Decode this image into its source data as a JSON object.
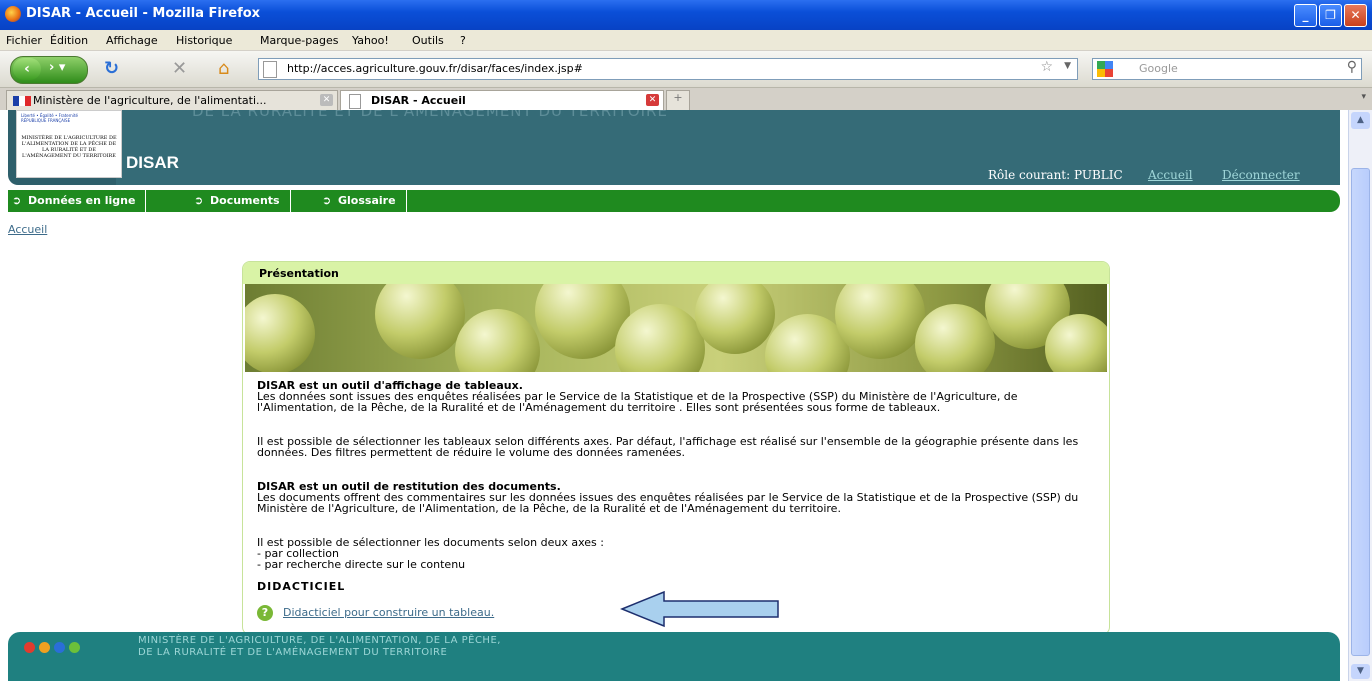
{
  "window": {
    "title": "DISAR - Accueil - Mozilla Firefox"
  },
  "menu": [
    "Fichier",
    "Édition",
    "Affichage",
    "Historique",
    "Marque-pages",
    "Yahoo!",
    "Outils",
    "?"
  ],
  "navbar": {
    "url": "http://acces.agriculture.gouv.fr/disar/faces/index.jsp#",
    "search_placeholder": "Google"
  },
  "tabs": [
    {
      "label": "Ministère de l'agriculture, de l'alimentati..."
    },
    {
      "label": "DISAR - Accueil"
    }
  ],
  "header": {
    "tagline": "DE LA RURALITÉ ET DE L'AMÉNAGEMENT DU TERRITOIRE",
    "logo_motto": "Liberté • Égalité • Fraternité",
    "logo_republic": "RÉPUBLIQUE FRANÇAISE",
    "logo_ministry": "MINISTÈRE DE L'AGRICULTURE DE L'ALIMENTATION DE LA PÊCHE DE LA RURALITÉ ET DE L'AMÉNAGEMENT DU TERRITOIRE",
    "app_name": "DISAR",
    "role": "Rôle courant: PUBLIC",
    "link_home": "Accueil",
    "link_logout": "Déconnecter"
  },
  "nav": [
    "Données en ligne",
    "Documents",
    "Glossaire"
  ],
  "breadcrumb": "Accueil",
  "panel": {
    "title": "Présentation",
    "h1": "DISAR est un outil d'affichage de tableaux.",
    "p1": "Les données sont issues des enquêtes réalisées par le Service de la Statistique et de la Prospective (SSP) du Ministère de l'Agriculture, de l'Alimentation, de la Pêche, de la Ruralité et de l'Aménagement du territoire . Elles sont présentées sous forme de tableaux.",
    "p2": "Il est possible de sélectionner les tableaux selon différents axes. Par défaut, l'affichage est réalisé sur l'ensemble de la géographie présente dans les données. Des filtres permettent de réduire le volume des données ramenées.",
    "h2": "DISAR est un outil de restitution des documents.",
    "p3": "Les documents offrent des commentaires sur les données issues des enquêtes réalisées par le Service de la Statistique et de la Prospective (SSP) du Ministère de l'Agriculture, de l'Alimentation, de la Pêche, de la Ruralité et de l'Aménagement du territoire.",
    "p4_intro": "Il est possible de sélectionner les documents selon deux axes :",
    "p4_item1": "- par collection",
    "p4_item2": "- par recherche directe sur le contenu",
    "didact_title": "DIDACTICIEL",
    "didact_link": "Didacticiel pour construire un tableau."
  },
  "footer": {
    "line1": "MINISTÈRE DE L'AGRICULTURE, DE L'ALIMENTATION, DE LA PÊCHE,",
    "line2": "DE LA RURALITÉ ET DE L'AMÉNAGEMENT DU TERRITOIRE"
  },
  "colors": {
    "header": "#2e5f6b",
    "nav_green": "#1f8a1f",
    "panel_head": "#d9f3a6",
    "footer": "#1f8080",
    "arrow": "#a9d0ee"
  }
}
